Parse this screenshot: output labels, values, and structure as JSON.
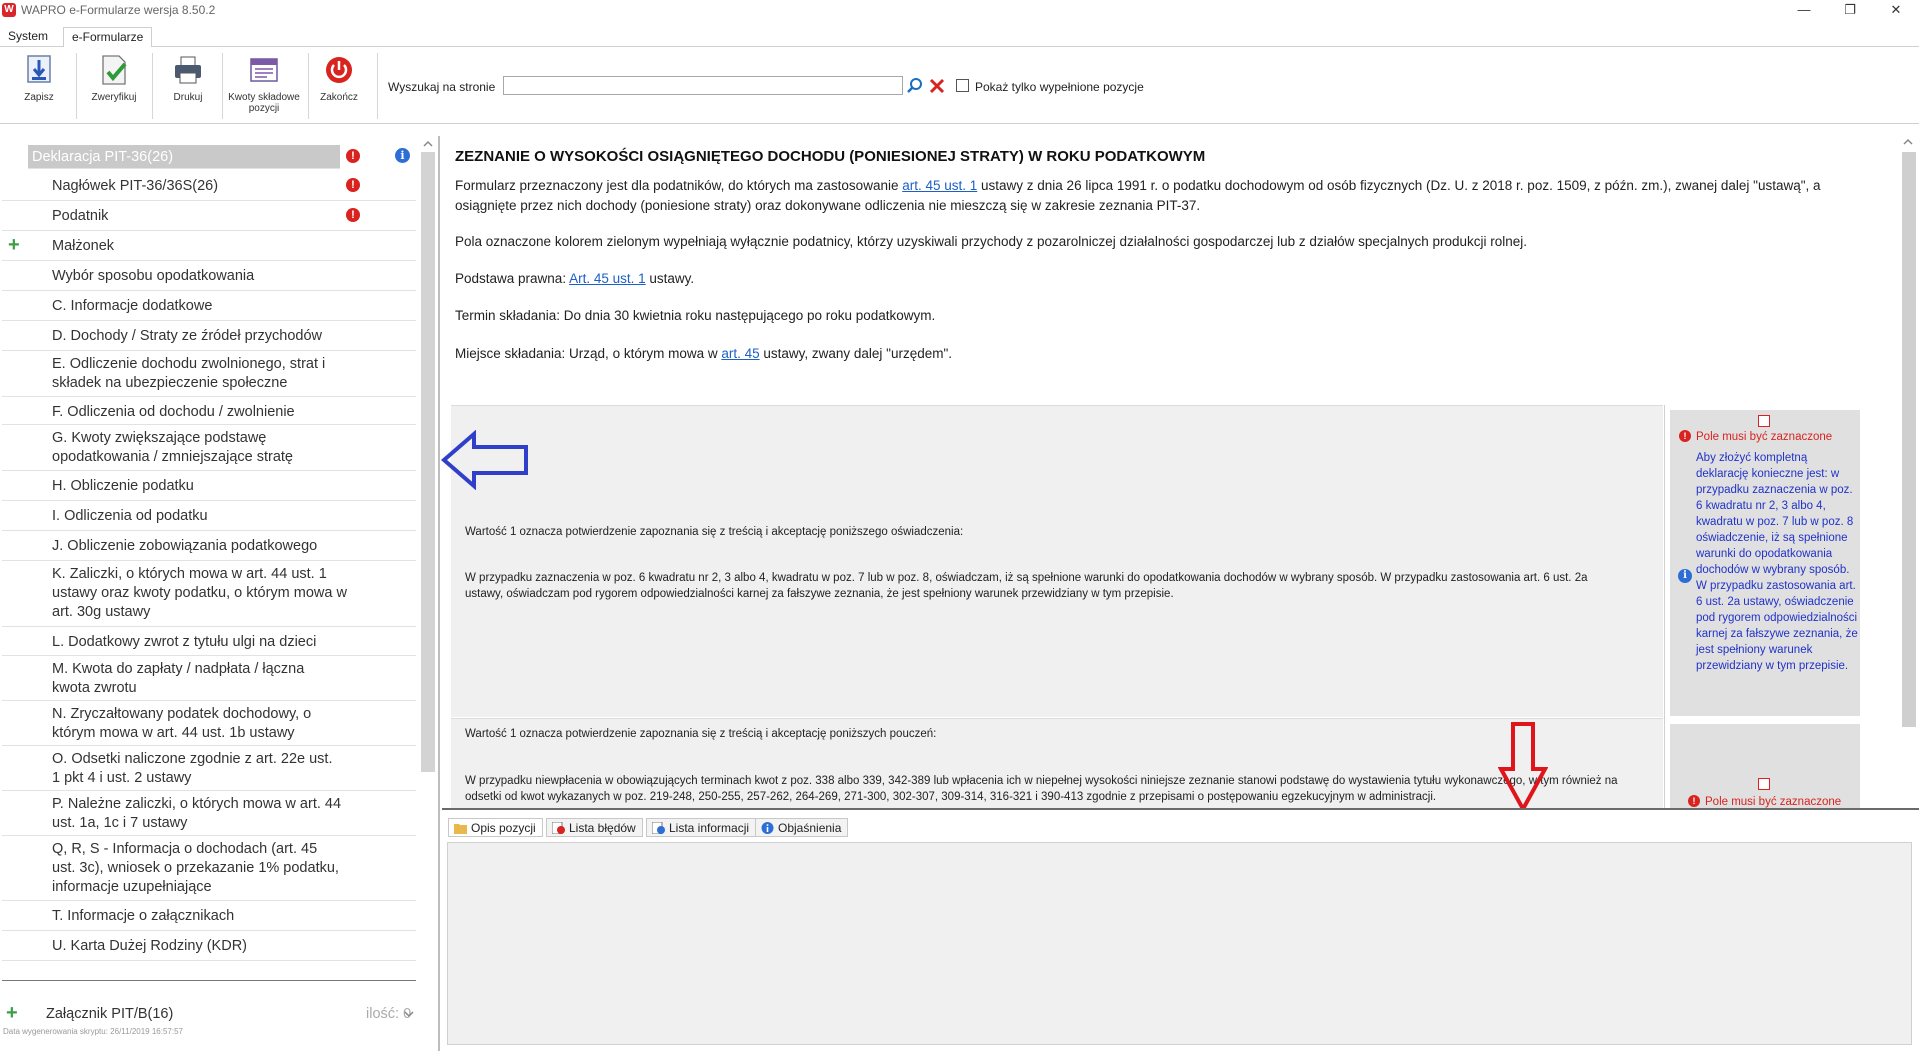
{
  "app": {
    "logo_letter": "W",
    "title": "WAPRO e-Formularze wersja 8.50.2",
    "win_minimize": "—",
    "win_restore": "❐",
    "win_close": "✕"
  },
  "menu_tabs": [
    "System",
    "e-Formularze"
  ],
  "toolbar": {
    "save_label": "Zapisz",
    "verify_label": "Zweryfikuj",
    "print_label": "Drukuj",
    "amounts_label": "Kwoty składowe pozycji",
    "exit_label": "Zakończ",
    "search_label": "Wyszukaj na stronie",
    "search_value": "",
    "filled_only_label": "Pokaż tylko wypełnione pozycje"
  },
  "nav": {
    "root": "Deklaracja PIT-36(26)",
    "items": [
      "Nagłówek PIT-36/36S(26)",
      "Podatnik",
      "Małżonek",
      "Wybór sposobu opodatkowania",
      "C. Informacje dodatkowe",
      "D. Dochody / Straty ze źródeł przychodów",
      "E. Odliczenie dochodu zwolnionego, strat i składek na ubezpieczenie społeczne",
      "F. Odliczenia od dochodu / zwolnienie",
      "G. Kwoty zwiększające podstawę opodatkowania / zmniejszające stratę",
      "H. Obliczenie podatku",
      "I. Odliczenia od podatku",
      "J. Obliczenie zobowiązania podatkowego",
      "K. Zaliczki, o których mowa w art. 44 ust. 1 ustawy oraz kwoty podatku, o którym mowa w art. 30g ustawy",
      "L. Dodatkowy zwrot z tytułu ulgi na dzieci",
      "M. Kwota do zapłaty / nadpłata / łączna kwota zwrotu",
      "N. Zryczałtowany podatek dochodowy, o którym mowa w art. 44 ust. 1b ustawy",
      "O. Odsetki naliczone zgodnie z art. 22e ust. 1 pkt 4 i ust. 2 ustawy",
      "P. Należne zaliczki, o których mowa w art. 44 ust. 1a, 1c i 7 ustawy",
      "Q, R, S - Informacja o dochodach (art. 45 ust. 3c), wniosek o przekazanie 1% podatku, informacje uzupełniające",
      "T. Informacje o załącznikach",
      "U. Karta Dużej Rodziny (KDR)"
    ],
    "attachment_label": "Załącznik PIT/B(16)",
    "attachment_count": "ilość: 0",
    "generated_date": "Data wygenerowania skryptu: 26/11/2019 16:57:57"
  },
  "content": {
    "title": "ZEZNANIE O WYSOKOŚCI OSIĄGNIĘTEGO DOCHODU (PONIESIONEJ STRATY) W ROKU PODATKOWYM",
    "p1_a": "Formularz przeznaczony jest dla podatników, do których ma zastosowanie ",
    "p1_link": "art. 45 ust. 1",
    "p1_b": " ustawy z dnia 26 lipca 1991 r. o podatku dochodowym od osób fizycznych (Dz. U. z 2018 r. poz. 1509, z późn. zm.), zwanej dalej \"ustawą\", a osiągnięte przez nich dochody (poniesione straty) oraz dokonywane odliczenia nie mieszczą się w zakresie zeznania PIT-37.",
    "p2": "Pola oznaczone kolorem zielonym wypełniają wyłącznie podatnicy, którzy uzyskiwali przychody z pozarolniczej działalności gospodarczej lub z działów specjalnych produkcji rolnej.",
    "p3_a": "Podstawa prawna: ",
    "p3_link": "Art. 45 ust. 1",
    "p3_b": " ustawy.",
    "p4": "Termin składania: Do dnia 30 kwietnia roku następującego po roku podatkowym.",
    "p5_a": "Miejsce składania: Urząd, o którym mowa w ",
    "p5_link": "art. 45",
    "p5_b": " ustawy, zwany dalej \"urzędem\".",
    "s1_heading": "Wartość 1 oznacza potwierdzenie zapoznania się z treścią i akceptację poniższego oświadczenia:",
    "s1_body": "W przypadku zaznaczenia w poz. 6 kwadratu nr 2, 3 albo 4, kwadratu w poz. 7 lub w poz. 8, oświadczam, iż są spełnione warunki do opodatkowania dochodów w wybrany sposób. W przypadku zastosowania art. 6 ust. 2a ustawy, oświadczam pod rygorem odpowiedzialności karnej za fałszywe zeznania, że jest spełniony warunek przewidziany w tym przepisie.",
    "s1_required": "Pole musi być zaznaczone",
    "s1_note": "Aby złożyć kompletną deklarację konieczne jest: w przypadku zaznaczenia w poz. 6 kwadratu nr 2, 3 albo 4, kwadratu w poz. 7 lub w poz. 8 oświadczenie, iż są spełnione warunki do opodatkowania dochodów w wybrany sposób. W przypadku zastosowania art. 6 ust. 2a ustawy, oświadczenie pod rygorem odpowiedzialności karnej za fałszywe zeznania, że jest spełniony warunek przewidziany w tym przepisie.",
    "s2_heading": "Wartość 1 oznacza potwierdzenie zapoznania się z treścią i akceptację poniższych pouczeń:",
    "s2_body": "W przypadku niewpłacenia w obowiązujących terminach kwot z poz. 338 albo 339, 342-389 lub wpłacenia ich w niepełnej wysokości niniejsze zeznanie stanowi podstawę do wystawienia tytułu wykonawczego, w tym również na odsetki od kwot wykazanych w poz. 219-248, 250-255, 257-262, 264-269, 271-300, 302-307, 309-314, 316-321 i 390-413 zgodnie z przepisami o postępowaniu egzekucyjnym w administracji.",
    "s2_required": "Pole musi być zaznaczone"
  },
  "bottom_tabs": [
    "Opis pozycji",
    "Lista błędów",
    "Lista informacji",
    "Objaśnienia"
  ],
  "colors": {
    "error": "#d9231f",
    "info": "#2d6ed6",
    "link": "#1c5fc7",
    "note_blue": "#2232c8",
    "annotation_blue": "#2f3fc9",
    "annotation_red": "#e0141b"
  }
}
